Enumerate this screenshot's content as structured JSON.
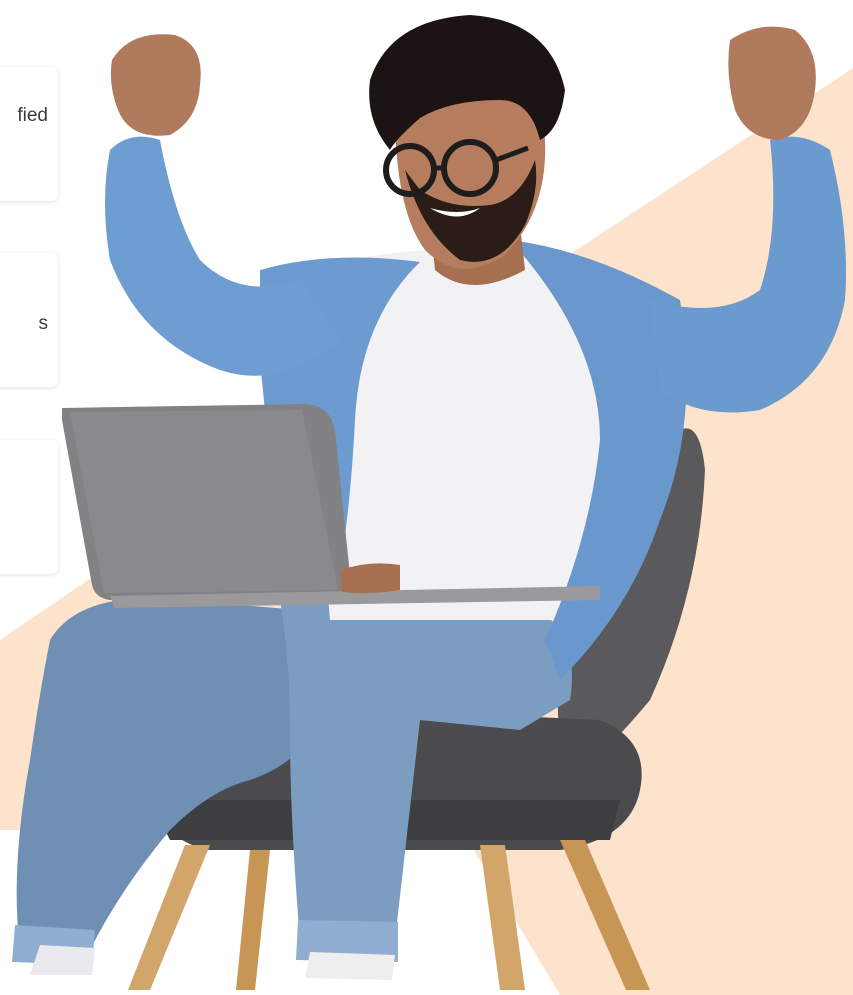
{
  "feature_cards": [
    {
      "text": "fied"
    },
    {
      "text": "s"
    },
    {
      "text": ""
    }
  ],
  "colors": {
    "accent_shape": "#fde3cc",
    "card_background": "#ffffff",
    "card_text": "#3c3c3c"
  },
  "hero": {
    "icon": "person-celebrating-with-laptop-illustration"
  }
}
